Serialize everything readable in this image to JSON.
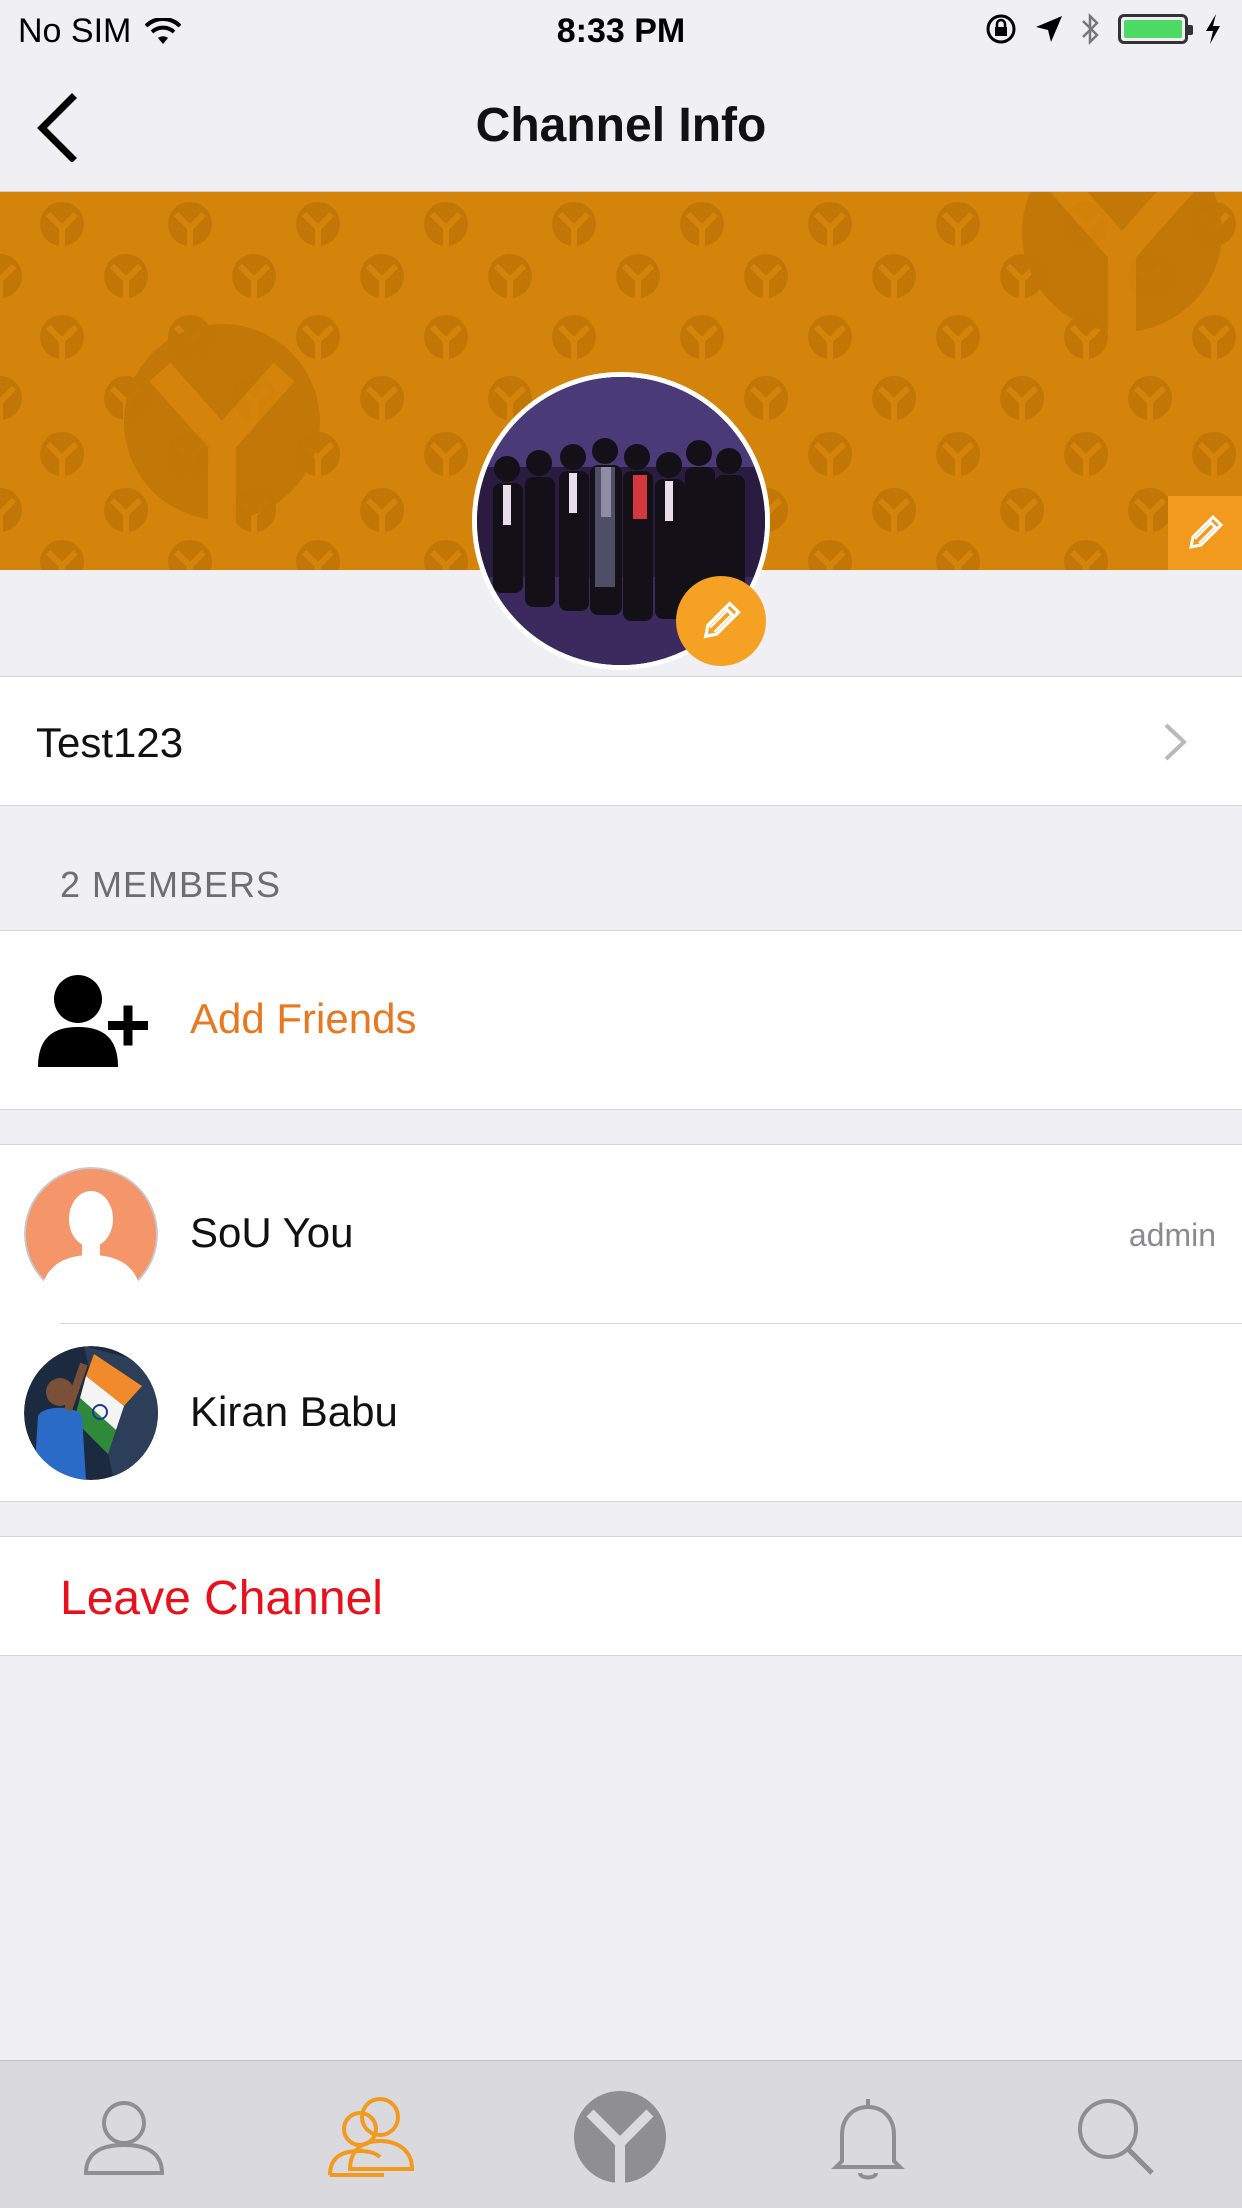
{
  "status_bar": {
    "carrier": "No SIM",
    "time": "8:33 PM"
  },
  "nav": {
    "title": "Channel Info",
    "back_icon": "chevron-left-icon"
  },
  "channel": {
    "name": "Test123"
  },
  "members_section": {
    "header": "2 MEMBERS",
    "add_label": "Add Friends",
    "members": [
      {
        "name": "SoU You",
        "role": "admin"
      },
      {
        "name": "Kiran Babu",
        "role": ""
      }
    ]
  },
  "actions": {
    "leave_label": "Leave Channel"
  },
  "tab_bar": {
    "items": [
      "profile-icon",
      "channels-icon",
      "home-logo-icon",
      "notifications-icon",
      "search-icon"
    ],
    "active": 1
  },
  "colors": {
    "accent": "#e87820",
    "banner": "#d4840a",
    "destructive": "#e8101a",
    "background": "#efeff4"
  }
}
